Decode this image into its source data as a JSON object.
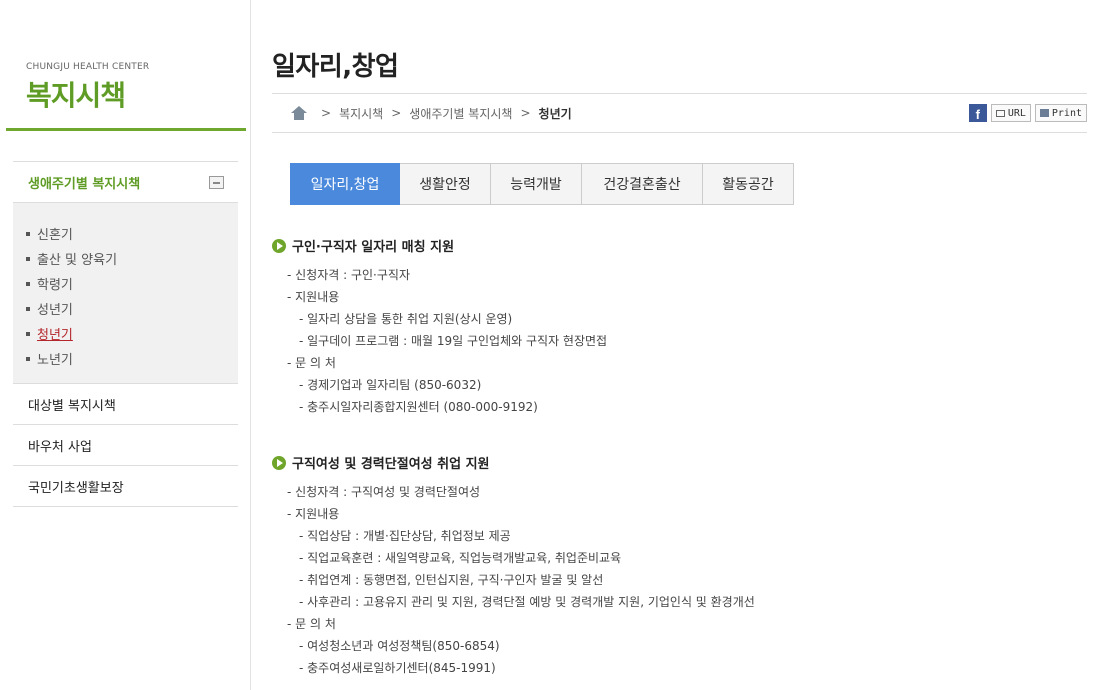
{
  "brand": {
    "subtitle": "CHUNGJU HEALTH CENTER",
    "title": "복지시책"
  },
  "sidebar": {
    "group_label": "생애주기별 복지시책",
    "sub_items": [
      {
        "label": "신혼기"
      },
      {
        "label": "출산 및 양육기"
      },
      {
        "label": "학령기"
      },
      {
        "label": "성년기"
      },
      {
        "label": "청년기",
        "active": true
      },
      {
        "label": "노년기"
      }
    ],
    "items": [
      {
        "label": "대상별 복지시책"
      },
      {
        "label": "바우처 사업"
      },
      {
        "label": "국민기초생활보장"
      }
    ]
  },
  "page": {
    "title": "일자리,창업"
  },
  "breadcrumb": {
    "items": [
      "복지시책",
      "생애주기별 복지시책",
      "청년기"
    ],
    "separator": ">"
  },
  "tools": {
    "facebook": "f",
    "url_label": "URL",
    "print_label": "Print"
  },
  "tabs": [
    {
      "label": "일자리,창업",
      "active": true
    },
    {
      "label": "생활안정"
    },
    {
      "label": "능력개발"
    },
    {
      "label": "건강결혼출산"
    },
    {
      "label": "활동공간"
    }
  ],
  "sections": [
    {
      "title": "구인·구직자 일자리 매칭 지원",
      "lines": [
        {
          "level": 1,
          "text": "- 신청자격 : 구인·구직자"
        },
        {
          "level": 1,
          "text": "- 지원내용"
        },
        {
          "level": 2,
          "text": "- 일자리 상담을 통한 취업 지원(상시 운영)"
        },
        {
          "level": 2,
          "text": "- 일구데이 프로그램 : 매월 19일 구인업체와 구직자 현장면접"
        },
        {
          "level": 1,
          "text": "- 문 의 처"
        },
        {
          "level": 2,
          "text": "- 경제기업과 일자리팀 (850-6032)"
        },
        {
          "level": 2,
          "text": "- 충주시일자리종합지원센터 (080-000-9192)"
        }
      ]
    },
    {
      "title": "구직여성 및 경력단절여성 취업 지원",
      "lines": [
        {
          "level": 1,
          "text": "- 신청자격 : 구직여성 및 경력단절여성"
        },
        {
          "level": 1,
          "text": "- 지원내용"
        },
        {
          "level": 2,
          "text": "- 직업상담 : 개별·집단상담, 취업정보 제공"
        },
        {
          "level": 2,
          "text": "- 직업교육훈련 : 새일역량교육, 직업능력개발교육, 취업준비교육"
        },
        {
          "level": 2,
          "text": "- 취업연계 : 동행면접, 인턴십지원, 구직·구인자 발굴 및 알선"
        },
        {
          "level": 2,
          "text": "- 사후관리 : 고용유지 관리 및 지원, 경력단절 예방 및 경력개발 지원, 기업인식 및 환경개선"
        },
        {
          "level": 1,
          "text": "- 문 의 처"
        },
        {
          "level": 2,
          "text": "- 여성청소년과 여성정책팀(850-6854)"
        },
        {
          "level": 2,
          "text": "- 충주여성새로일하기센터(845-1991)"
        }
      ]
    }
  ]
}
